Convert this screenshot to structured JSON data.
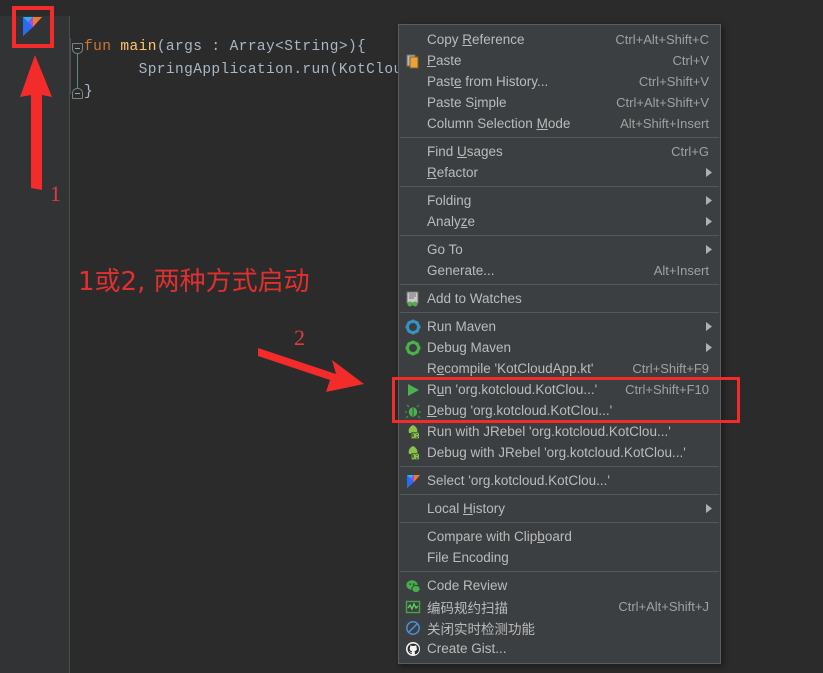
{
  "editor": {
    "code_lines": [
      {
        "id": "l1",
        "parts": [
          {
            "t": "fun ",
            "c": "kw"
          },
          {
            "t": "main",
            "c": "fn"
          },
          {
            "t": "(args : Array<String>){",
            "c": "pl"
          }
        ]
      },
      {
        "id": "l2",
        "parts": [
          {
            "t": "      SpringApplication.run(KotClou",
            "c": "pl"
          }
        ]
      },
      {
        "id": "l3",
        "parts": [
          {
            "t": "}",
            "c": "pl"
          }
        ]
      }
    ],
    "line1_text": "fun main(args : Array<String>){",
    "line2_text": "      SpringApplication.run(KotClou",
    "line3_text": "}",
    "gutter_icon_name": "kotlin-run-gutter-icon"
  },
  "annotations": {
    "marker_1": "1",
    "marker_2": "2",
    "note_cn": "1或2, 两种方式启动",
    "highlight_color": "#f32b2b"
  },
  "context_menu": {
    "groups": [
      {
        "items": [
          {
            "label": "Copy Reference",
            "mnemonic": "R",
            "shortcut": "Ctrl+Alt+Shift+C",
            "icon": null,
            "submenu": false,
            "name": "menu-item-copy-reference"
          },
          {
            "label": "Paste",
            "mnemonic": "P",
            "shortcut": "Ctrl+V",
            "icon": "paste-icon",
            "submenu": false,
            "name": "menu-item-paste"
          },
          {
            "label": "Paste from History...",
            "mnemonic": "e",
            "shortcut": "Ctrl+Shift+V",
            "icon": null,
            "submenu": false,
            "name": "menu-item-paste-from-history"
          },
          {
            "label": "Paste Simple",
            "mnemonic": "i",
            "shortcut": "Ctrl+Alt+Shift+V",
            "icon": null,
            "submenu": false,
            "name": "menu-item-paste-simple"
          },
          {
            "label": "Column Selection Mode",
            "mnemonic": "M",
            "shortcut": "Alt+Shift+Insert",
            "icon": null,
            "submenu": false,
            "name": "menu-item-column-selection-mode"
          }
        ]
      },
      {
        "items": [
          {
            "label": "Find Usages",
            "mnemonic": "U",
            "shortcut": "Ctrl+G",
            "icon": null,
            "submenu": false,
            "name": "menu-item-find-usages"
          },
          {
            "label": "Refactor",
            "mnemonic": "R",
            "shortcut": "",
            "icon": null,
            "submenu": true,
            "name": "menu-item-refactor"
          }
        ]
      },
      {
        "items": [
          {
            "label": "Folding",
            "mnemonic": "",
            "shortcut": "",
            "icon": null,
            "submenu": true,
            "name": "menu-item-folding"
          },
          {
            "label": "Analyze",
            "mnemonic": "z",
            "shortcut": "",
            "icon": null,
            "submenu": true,
            "name": "menu-item-analyze"
          }
        ]
      },
      {
        "items": [
          {
            "label": "Go To",
            "mnemonic": "",
            "shortcut": "",
            "icon": null,
            "submenu": true,
            "name": "menu-item-go-to"
          },
          {
            "label": "Generate...",
            "mnemonic": "",
            "shortcut": "Alt+Insert",
            "icon": null,
            "submenu": false,
            "name": "menu-item-generate"
          }
        ]
      },
      {
        "items": [
          {
            "label": "Add to Watches",
            "mnemonic": "",
            "shortcut": "",
            "icon": "watches-icon",
            "submenu": false,
            "name": "menu-item-add-to-watches"
          }
        ]
      },
      {
        "items": [
          {
            "label": "Run Maven",
            "mnemonic": "",
            "shortcut": "",
            "icon": "maven-run-icon",
            "submenu": true,
            "name": "menu-item-run-maven"
          },
          {
            "label": "Debug Maven",
            "mnemonic": "",
            "shortcut": "",
            "icon": "maven-debug-icon",
            "submenu": true,
            "name": "menu-item-debug-maven"
          },
          {
            "label": "Recompile 'KotCloudApp.kt'",
            "mnemonic": "e",
            "shortcut": "Ctrl+Shift+F9",
            "icon": null,
            "submenu": false,
            "name": "menu-item-recompile"
          },
          {
            "label": "Run 'org.kotcloud.KotClou...'",
            "mnemonic": "u",
            "shortcut": "Ctrl+Shift+F10",
            "icon": "run-icon",
            "submenu": false,
            "name": "menu-item-run-main",
            "highlighted": true
          },
          {
            "label": "Debug 'org.kotcloud.KotClou...'",
            "mnemonic": "D",
            "shortcut": "",
            "icon": "debug-icon",
            "submenu": false,
            "name": "menu-item-debug-main",
            "highlighted": true
          },
          {
            "label": "Run with JRebel 'org.kotcloud.KotClou...'",
            "mnemonic": "",
            "shortcut": "",
            "icon": "jrebel-run-icon",
            "submenu": false,
            "name": "menu-item-run-with-jrebel"
          },
          {
            "label": "Debug with JRebel 'org.kotcloud.KotClou...'",
            "mnemonic": "",
            "shortcut": "",
            "icon": "jrebel-debug-icon",
            "submenu": false,
            "name": "menu-item-debug-with-jrebel"
          }
        ]
      },
      {
        "items": [
          {
            "label": "Select 'org.kotcloud.KotClou...'",
            "mnemonic": "",
            "shortcut": "",
            "icon": "kotlin-icon",
            "submenu": false,
            "name": "menu-item-select-config"
          }
        ]
      },
      {
        "items": [
          {
            "label": "Local History",
            "mnemonic": "H",
            "shortcut": "",
            "icon": null,
            "submenu": true,
            "name": "menu-item-local-history"
          }
        ]
      },
      {
        "items": [
          {
            "label": "Compare with Clipboard",
            "mnemonic": "b",
            "shortcut": "",
            "icon": null,
            "submenu": false,
            "name": "menu-item-compare-with-clipboard"
          },
          {
            "label": "File Encoding",
            "mnemonic": "",
            "shortcut": "",
            "icon": null,
            "submenu": false,
            "name": "menu-item-file-encoding"
          }
        ]
      },
      {
        "items": [
          {
            "label": "Code Review",
            "mnemonic": "",
            "shortcut": "",
            "icon": "code-review-icon",
            "submenu": false,
            "name": "menu-item-code-review"
          },
          {
            "label": "编码规约扫描",
            "mnemonic": "",
            "shortcut": "Ctrl+Alt+Shift+J",
            "icon": "scan-icon",
            "submenu": false,
            "name": "menu-item-code-scan"
          },
          {
            "label": "关闭实时检测功能",
            "mnemonic": "",
            "shortcut": "",
            "icon": "disable-icon",
            "submenu": false,
            "name": "menu-item-disable-realtime-check"
          },
          {
            "label": "Create Gist...",
            "mnemonic": "",
            "shortcut": "",
            "icon": "github-icon",
            "submenu": false,
            "name": "menu-item-create-gist"
          }
        ]
      }
    ]
  }
}
